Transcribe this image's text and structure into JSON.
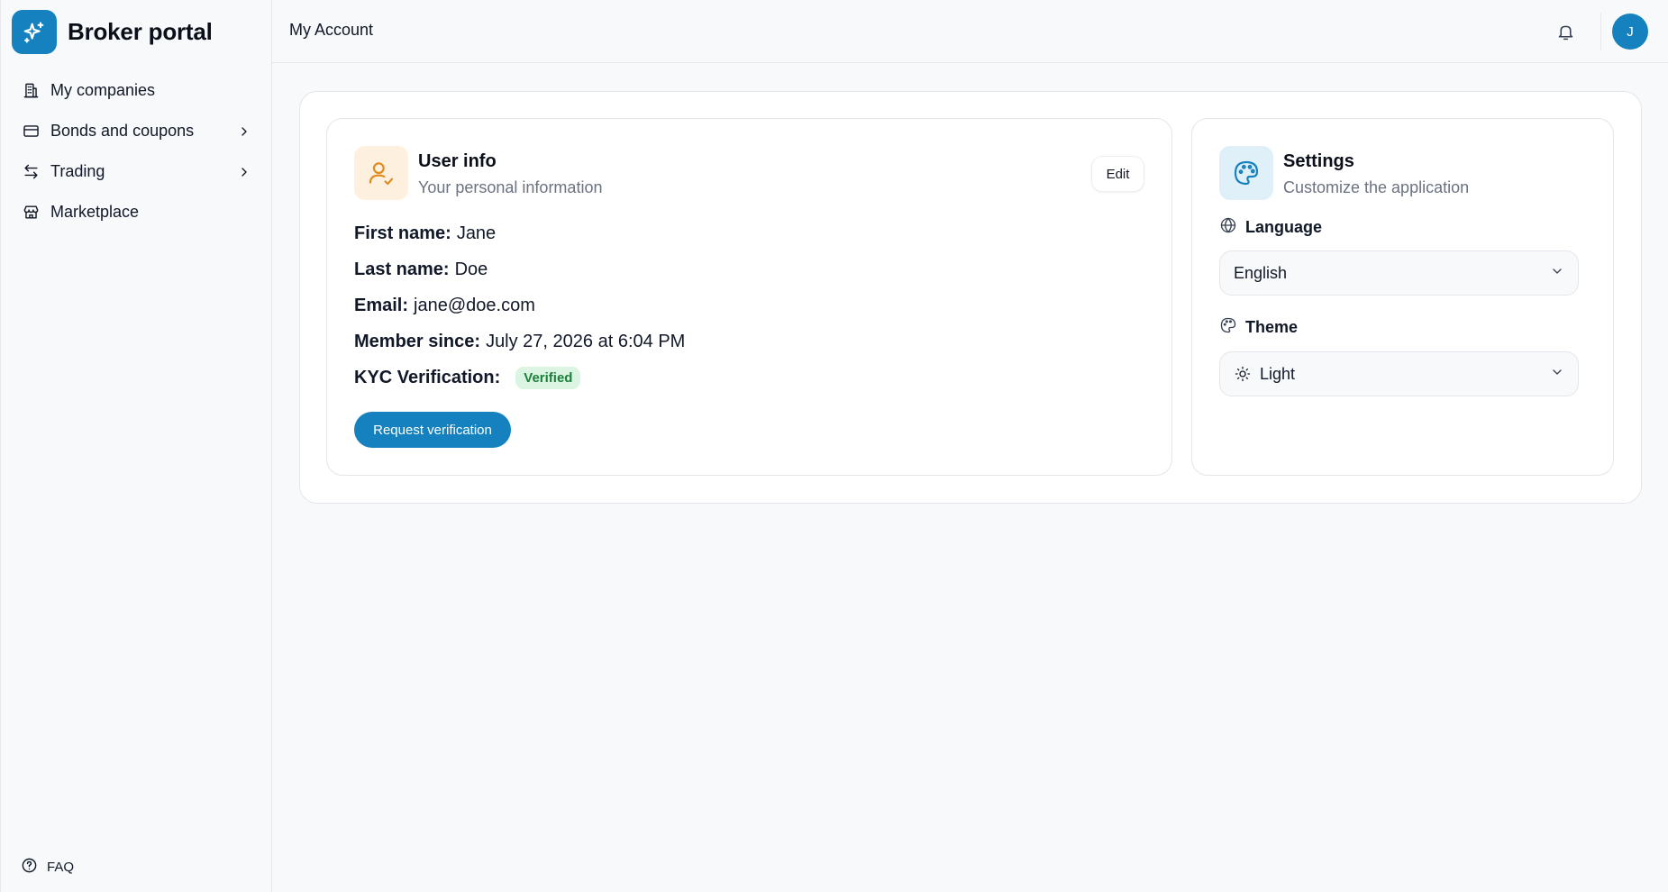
{
  "brand": {
    "title": "Broker portal",
    "color": "#1582bf"
  },
  "sidebar": {
    "items": [
      {
        "label": "My companies",
        "icon": "building-icon"
      },
      {
        "label": "Bonds and coupons",
        "icon": "credit-card-icon",
        "expandable": true
      },
      {
        "label": "Trading",
        "icon": "arrows-exchange-icon",
        "expandable": true
      },
      {
        "label": "Marketplace",
        "icon": "store-icon"
      }
    ],
    "faq": {
      "label": "FAQ",
      "icon": "help-circle-icon"
    }
  },
  "header": {
    "title": "My Account",
    "avatar_initial": "J"
  },
  "user_info": {
    "title": "User info",
    "subtitle": "Your personal information",
    "edit_label": "Edit",
    "fields": [
      {
        "label": "First name:",
        "value": "Jane"
      },
      {
        "label": "Last name:",
        "value": "Doe"
      },
      {
        "label": "Email:",
        "value": "jane@doe.com"
      },
      {
        "label": "Member since:",
        "value": "July 27, 2026 at 6:04 PM"
      }
    ],
    "kyc": {
      "label": "KYC Verification:",
      "status": "Verified"
    },
    "request_label": "Request verification"
  },
  "settings": {
    "title": "Settings",
    "subtitle": "Customize the application",
    "language": {
      "label": "Language",
      "value": "English"
    },
    "theme": {
      "label": "Theme",
      "value": "Light"
    }
  }
}
